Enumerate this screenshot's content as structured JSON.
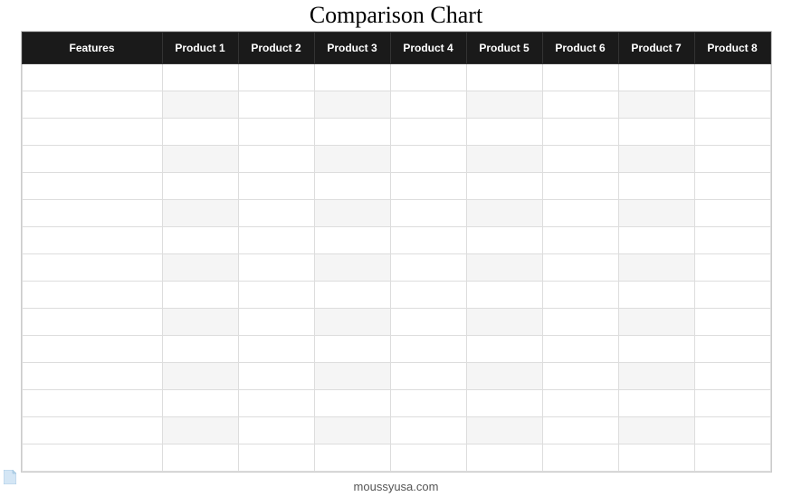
{
  "title": "Comparison Chart",
  "headers": {
    "features": "Features",
    "products": [
      "Product 1",
      "Product 2",
      "Product 3",
      "Product 4",
      "Product 5",
      "Product 6",
      "Product 7",
      "Product 8"
    ]
  },
  "rows": 15,
  "footer": "moussyusa.com",
  "chart_data": {
    "type": "table",
    "title": "Comparison Chart",
    "columns": [
      "Features",
      "Product 1",
      "Product 2",
      "Product 3",
      "Product 4",
      "Product 5",
      "Product 6",
      "Product 7",
      "Product 8"
    ],
    "data": []
  }
}
